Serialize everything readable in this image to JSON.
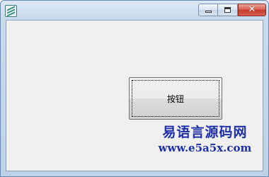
{
  "window": {
    "title_icon": "app-icon",
    "controls": {
      "minimize_icon": "minimize-icon",
      "maximize_icon": "maximize-icon",
      "close_glyph": "✕"
    }
  },
  "button": {
    "label": "按钮"
  },
  "watermark": {
    "title": "易语言源码网",
    "url": "www.e5a5x.com",
    "color": "#1f2fa6"
  }
}
